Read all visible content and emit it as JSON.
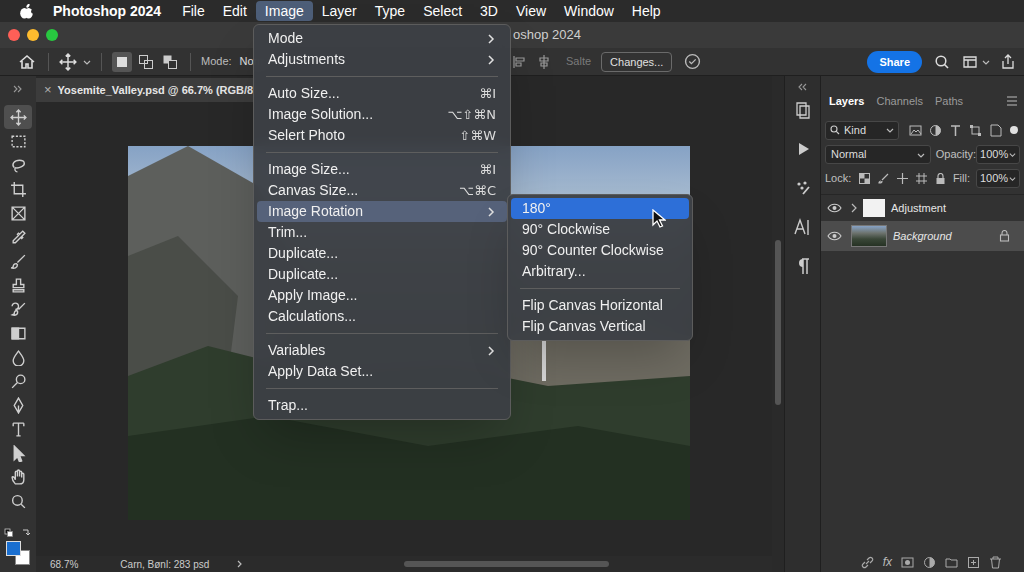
{
  "menubar": {
    "app": "Photoshop 2024",
    "items": [
      {
        "label": "File",
        "selected": false
      },
      {
        "label": "Edit",
        "selected": false
      },
      {
        "label": "Image",
        "selected": true
      },
      {
        "label": "Layer",
        "selected": false
      },
      {
        "label": "Type",
        "selected": false
      },
      {
        "label": "Select",
        "selected": false
      },
      {
        "label": "3D",
        "selected": false
      },
      {
        "label": "View",
        "selected": false
      },
      {
        "label": "Window",
        "selected": false
      },
      {
        "label": "Help",
        "selected": false
      }
    ]
  },
  "window": {
    "title": "oshop 2024"
  },
  "options_bar": {
    "mode_label": "Mode:",
    "mode_value": "Norm",
    "dimmed_label": "Salte",
    "changes_button": "Changes...",
    "share_button": "Share",
    "selection_modes": [
      {
        "selected": true
      },
      {
        "selected": false
      },
      {
        "selected": false
      }
    ]
  },
  "document_tab": {
    "close": "×",
    "title": "Yosemite_Valley.psd @ 66.7% (RGB/8"
  },
  "tools": [
    {
      "selected": true
    },
    {
      "selected": false
    },
    {
      "selected": false
    },
    {
      "selected": false
    },
    {
      "selected": false
    },
    {
      "selected": false
    },
    {
      "selected": false
    },
    {
      "selected": false
    },
    {
      "selected": false
    },
    {
      "selected": false
    },
    {
      "selected": false
    },
    {
      "selected": false
    },
    {
      "selected": false
    },
    {
      "selected": false
    },
    {
      "selected": false
    },
    {
      "selected": false
    },
    {
      "selected": false
    }
  ],
  "swatches": {
    "foreground": "#1a6fd0",
    "background": "#ffffff"
  },
  "image_menu": {
    "items": [
      {
        "kind": "submenu",
        "label": "Mode",
        "selected": false
      },
      {
        "kind": "submenu",
        "label": "Adjustments",
        "selected": false
      },
      {
        "kind": "separator"
      },
      {
        "kind": "item",
        "label": "Auto Size...",
        "shortcut": "⌘I",
        "selected": false
      },
      {
        "kind": "item",
        "label": "Image Solution...",
        "shortcut": "⌥⇧⌘N",
        "selected": false
      },
      {
        "kind": "item",
        "label": "Selert Photo",
        "shortcut": "⇧⌘W",
        "selected": false
      },
      {
        "kind": "separator"
      },
      {
        "kind": "item",
        "label": "Image Size...",
        "shortcut": "⌘I",
        "selected": false
      },
      {
        "kind": "item",
        "label": "Canvas Size...",
        "shortcut": "⌥⌘C",
        "selected": false
      },
      {
        "kind": "submenu",
        "label": "Image Rotation",
        "selected": true
      },
      {
        "kind": "item",
        "label": "Trim...",
        "selected": false
      },
      {
        "kind": "item",
        "label": "Duplicate...",
        "selected": false
      },
      {
        "kind": "item",
        "label": "Duplicate...",
        "selected": false
      },
      {
        "kind": "item",
        "label": "Apply Image...",
        "selected": false
      },
      {
        "kind": "item",
        "label": "Calculations...",
        "selected": false
      },
      {
        "kind": "separator"
      },
      {
        "kind": "submenu",
        "label": "Variables",
        "selected": false
      },
      {
        "kind": "item",
        "label": "Apply Data Set...",
        "selected": false
      },
      {
        "kind": "separator"
      },
      {
        "kind": "item",
        "label": "Trap...",
        "selected": false
      }
    ]
  },
  "rotation_submenu": {
    "items": [
      {
        "kind": "item",
        "label": "180°",
        "selected": true
      },
      {
        "kind": "item",
        "label": "90° Clockwise",
        "selected": false
      },
      {
        "kind": "item",
        "label": "90° Counter Clockwise",
        "selected": false
      },
      {
        "kind": "item",
        "label": "Arbitrary...",
        "selected": false
      },
      {
        "kind": "separator"
      },
      {
        "kind": "item",
        "label": "Flip Canvas Horizontal",
        "selected": false
      },
      {
        "kind": "item",
        "label": "Flip Canvas Vertical",
        "selected": false
      }
    ]
  },
  "layers_panel": {
    "tabs": [
      {
        "label": "Layers",
        "selected": true
      },
      {
        "label": "Channels",
        "selected": false
      },
      {
        "label": "Paths",
        "selected": false
      }
    ],
    "filter": "Kind",
    "blend_mode": "Normal",
    "opacity_label": "Opacity:",
    "opacity": "100%",
    "lock_label": "Lock:",
    "fill_label": "Fill:",
    "fill": "100%",
    "layers": [
      {
        "name": "Adjustment",
        "kind": "group",
        "visible": true,
        "selected": false,
        "expanded": false,
        "locked": false
      },
      {
        "name": "Background",
        "kind": "image",
        "visible": true,
        "selected": true,
        "expanded": false,
        "locked": true
      }
    ],
    "footer_fx": "fx"
  },
  "status_bar": {
    "zoom": "68.7%",
    "info": "Carn, Bønl: 283 psd"
  }
}
